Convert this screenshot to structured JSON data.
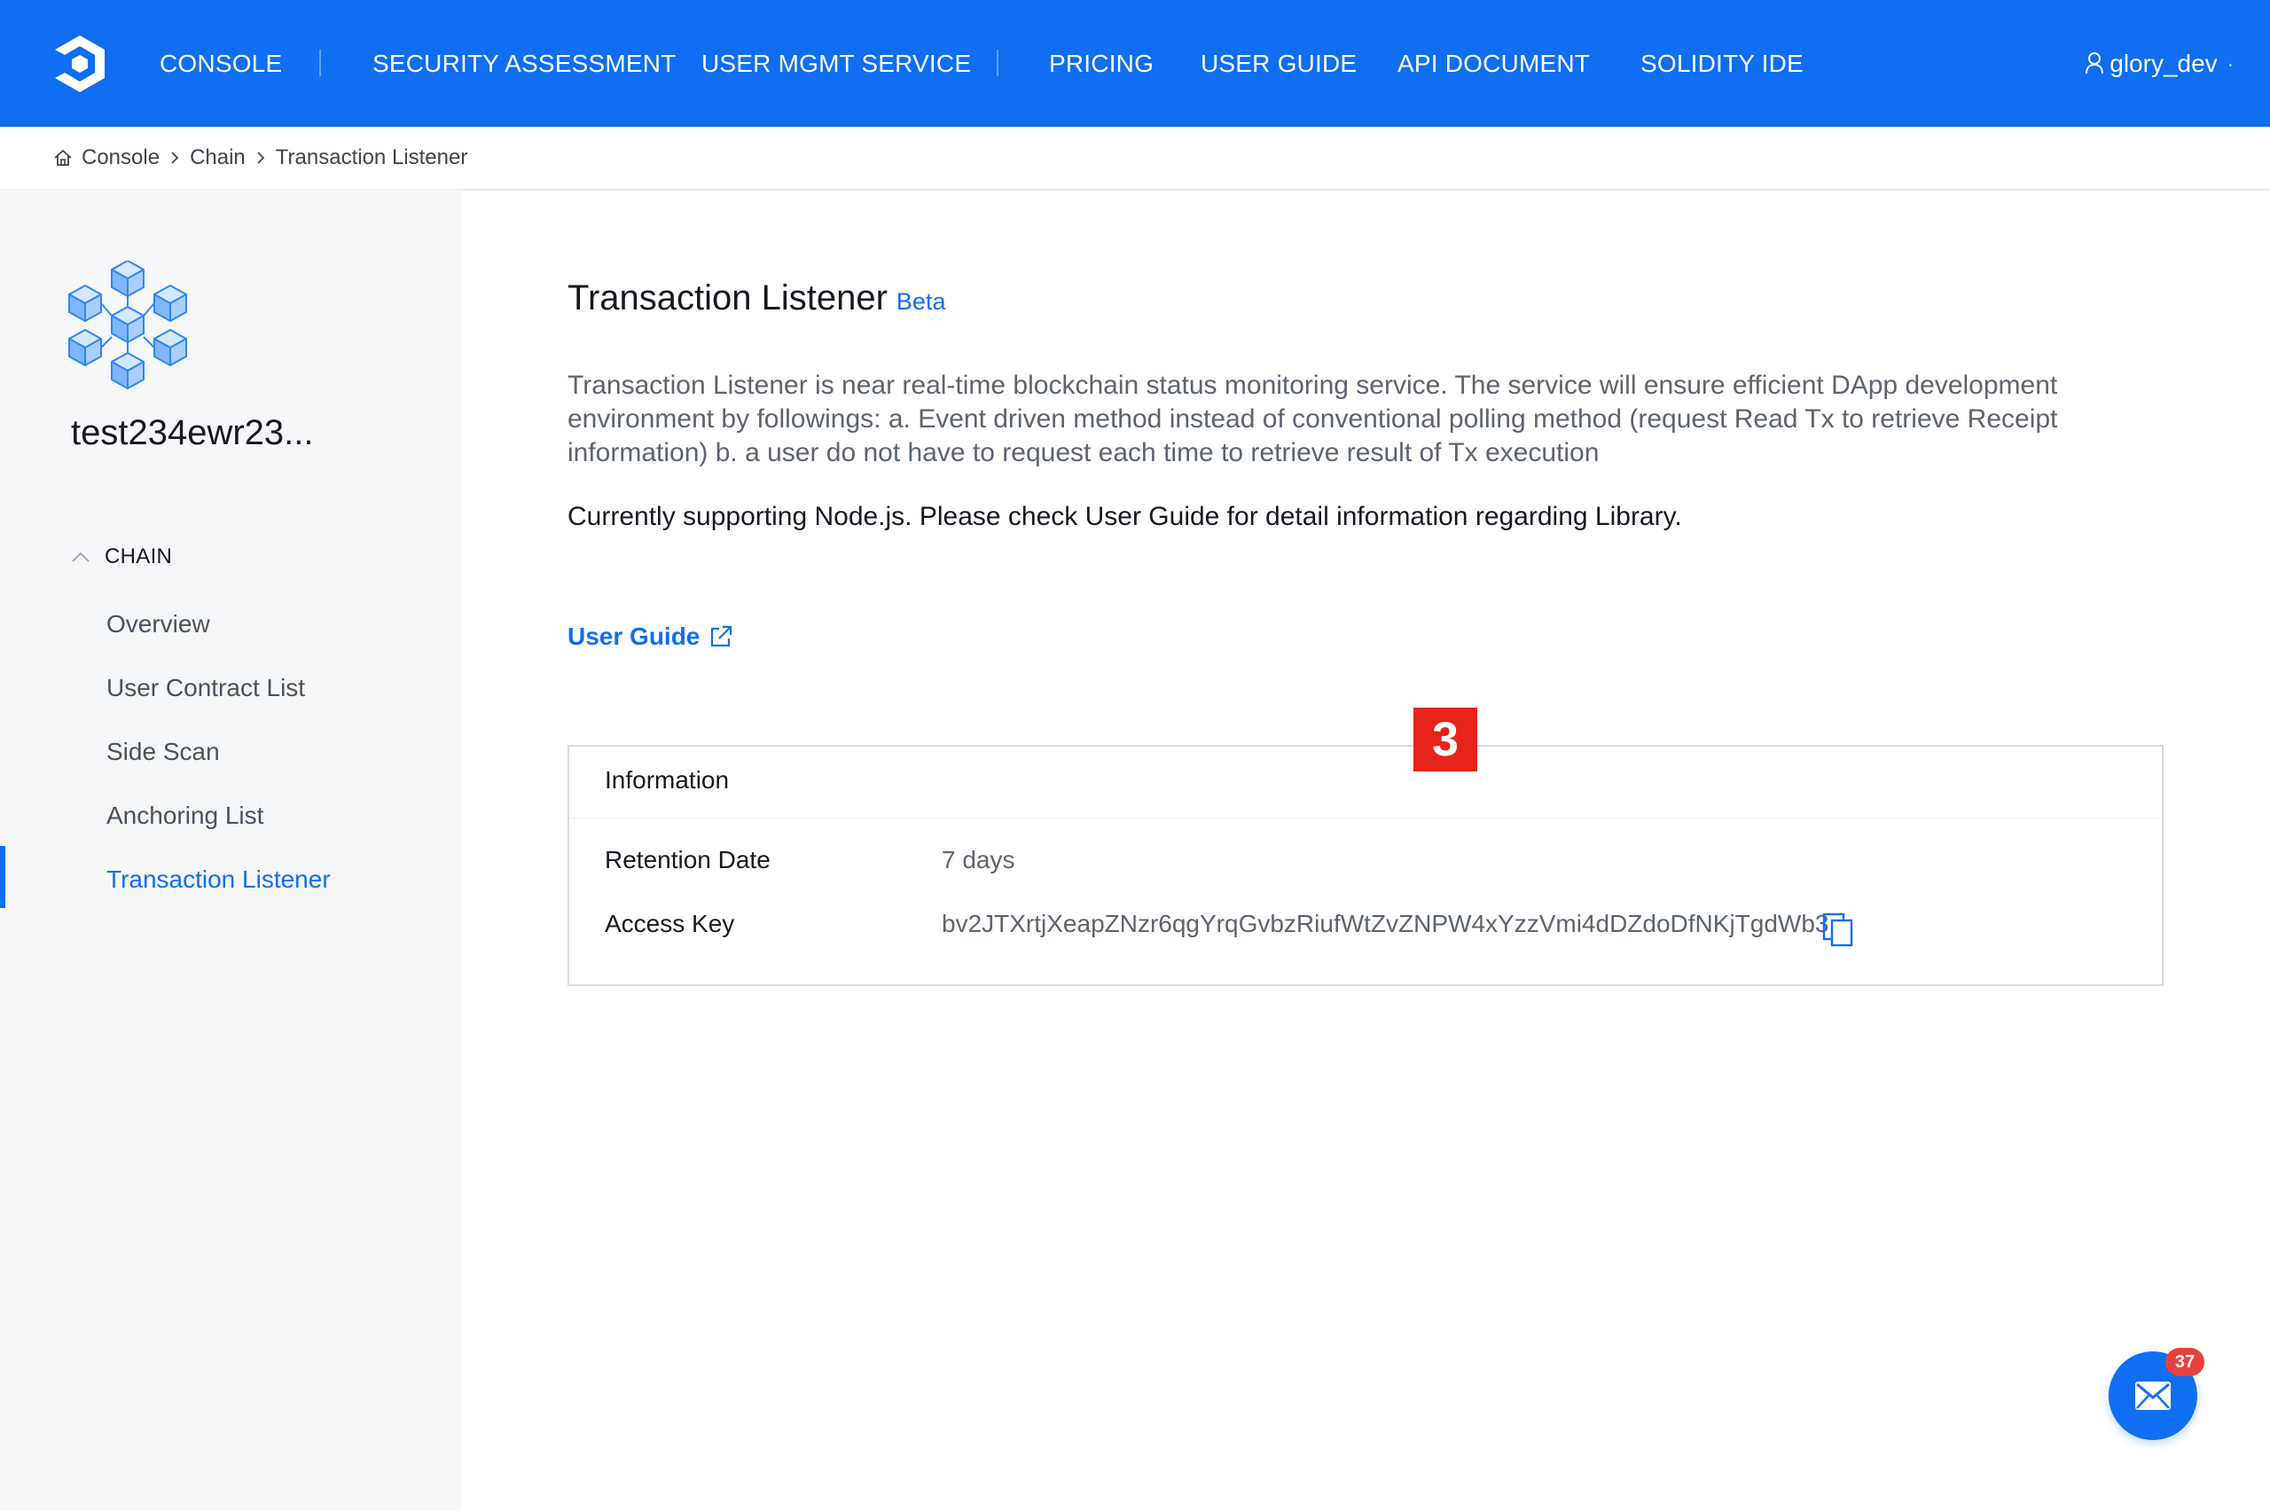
{
  "header": {
    "nav": [
      {
        "label": "CONSOLE"
      },
      {
        "label": "SECURITY ASSESSMENT"
      },
      {
        "label": "USER MGMT SERVICE"
      },
      {
        "label": "PRICING"
      },
      {
        "label": "USER GUIDE"
      },
      {
        "label": "API DOCUMENT"
      },
      {
        "label": "SOLIDITY IDE"
      }
    ],
    "username": "glory_dev",
    "user_icon": "user-icon",
    "logo_icon": "brand-logo-icon"
  },
  "breadcrumb": {
    "home_icon": "home-icon",
    "items": [
      "Console",
      "Chain",
      "Transaction Listener"
    ]
  },
  "sidebar": {
    "project_icon": "blockchain-cubes-icon",
    "project_name": "test234ewr23...",
    "section_label": "CHAIN",
    "items": [
      {
        "label": "Overview"
      },
      {
        "label": "User Contract List"
      },
      {
        "label": "Side Scan"
      },
      {
        "label": "Anchoring List"
      },
      {
        "label": "Transaction Listener"
      }
    ],
    "active_item": "Transaction Listener"
  },
  "main": {
    "title": "Transaction Listener",
    "badge": "Beta",
    "description": "Transaction Listener is near real-time blockchain status monitoring service. The service will ensure efficient DApp development environment by followings: a. Event driven method instead of conventional polling method (request Read Tx to retrieve Receipt information) b. a user do not have to request each time to retrieve result of Tx execution",
    "support_note": "Currently supporting Node.js. Please check User Guide for detail information regarding Library.",
    "guide_link": "User Guide",
    "info": {
      "heading": "Information",
      "rows": [
        {
          "label": "Retention Date",
          "value": "7 days"
        },
        {
          "label": "Access Key",
          "value": "bv2JTXrtjXeapZNzr6qgYrqGvbzRiufWtZvZNPW4xYzzVmi4dDZdoDfNKjTgdWb3"
        }
      ]
    },
    "annotation_badge": "3"
  },
  "chat": {
    "unread_count": "37",
    "icon": "mail-icon"
  },
  "colors": {
    "primary": "#0f6ef2",
    "sidebar_bg": "#f6f7f9",
    "annotation_red": "#e8231b",
    "notification_red": "#e7423b"
  }
}
